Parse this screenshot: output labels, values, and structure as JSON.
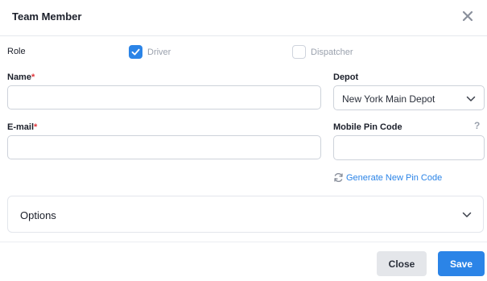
{
  "dialog": {
    "title": "Team Member",
    "close_icon": "close-icon"
  },
  "role": {
    "label": "Role",
    "options": [
      {
        "label": "Driver",
        "checked": true
      },
      {
        "label": "Dispatcher",
        "checked": false
      }
    ]
  },
  "fields": {
    "name": {
      "label": "Name",
      "required_mark": "*",
      "value": ""
    },
    "email": {
      "label": "E-mail",
      "required_mark": "*",
      "value": ""
    },
    "depot": {
      "label": "Depot",
      "selected": "New York Main Depot"
    },
    "pin": {
      "label": "Mobile Pin Code",
      "value": "",
      "help": "?"
    }
  },
  "generate_pin": {
    "label": "Generate New Pin Code",
    "icon": "refresh-icon"
  },
  "options_section": {
    "label": "Options",
    "expanded": false
  },
  "footer": {
    "close_label": "Close",
    "save_label": "Save"
  },
  "colors": {
    "accent": "#2b84e7",
    "required": "#e0353b",
    "muted": "#9aa1ad"
  }
}
